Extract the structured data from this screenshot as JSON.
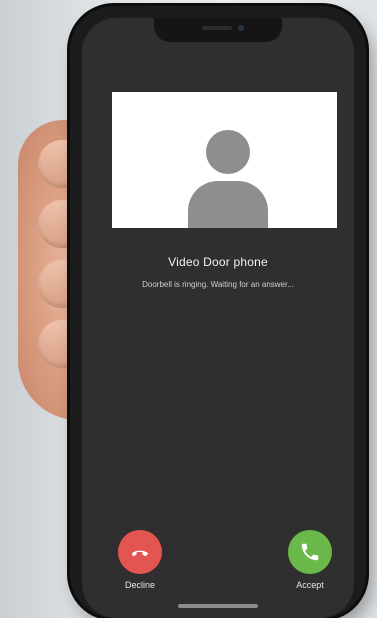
{
  "call": {
    "title": "Video Door phone",
    "status": "Doorbell is ringing. Waiting for an answer...",
    "caller_avatar_icon": "person-placeholder-icon"
  },
  "actions": {
    "decline_label": "Decline",
    "accept_label": "Accept",
    "decline_icon": "phone-hangup-icon",
    "accept_icon": "phone-icon",
    "decline_color": "#e25550",
    "accept_color": "#6ab94a"
  },
  "colors": {
    "screen_background": "#2f2f30",
    "video_background": "#ffffff",
    "avatar": "#8e8e8e"
  }
}
